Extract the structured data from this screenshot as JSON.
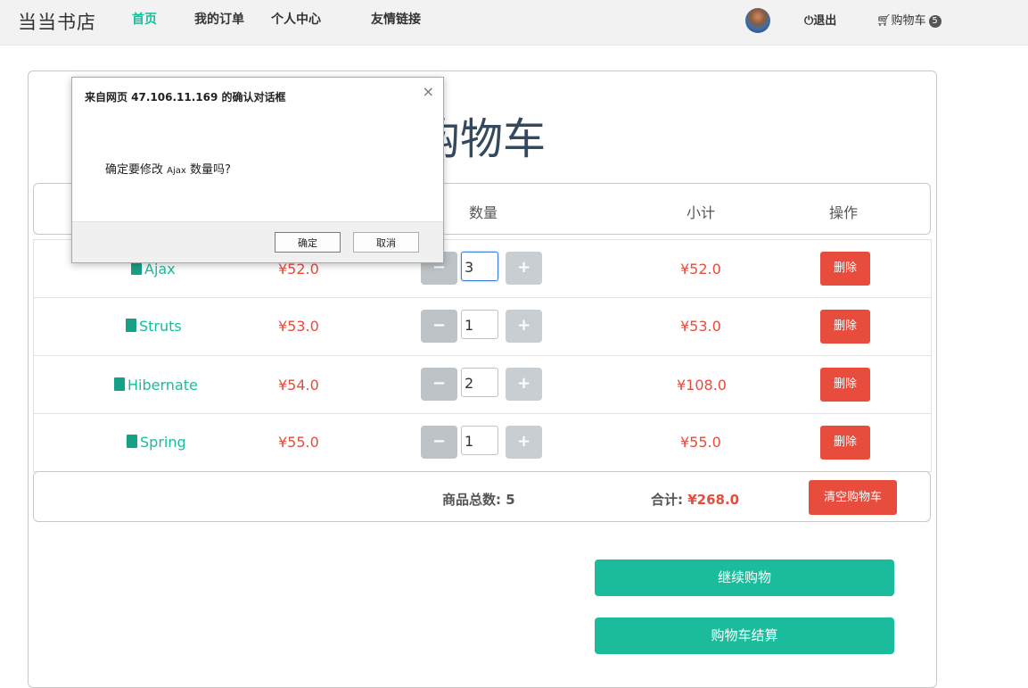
{
  "navbar": {
    "brand": "当当书店",
    "links": [
      "首页",
      "我的订单",
      "个人中心",
      "友情链接"
    ],
    "logout": "退出",
    "cart": "购物车",
    "cart_count": "5"
  },
  "page": {
    "title": "购物车"
  },
  "table": {
    "headers": {
      "qty": "数量",
      "subtotal": "小计",
      "action": "操作"
    },
    "rows": [
      {
        "name": "Ajax",
        "price": "¥52.0",
        "qty": "3",
        "subtotal": "¥52.0",
        "delete": "删除"
      },
      {
        "name": "Struts",
        "price": "¥53.0",
        "qty": "1",
        "subtotal": "¥53.0",
        "delete": "删除"
      },
      {
        "name": "Hibernate",
        "price": "¥54.0",
        "qty": "2",
        "subtotal": "¥108.0",
        "delete": "删除"
      },
      {
        "name": "Spring",
        "price": "¥55.0",
        "qty": "1",
        "subtotal": "¥55.0",
        "delete": "删除"
      }
    ],
    "minus": "−",
    "plus": "+"
  },
  "summary": {
    "count_label": "商品总数:",
    "count_value": "5",
    "sum_label": "合计:",
    "sum_value": "¥268.0",
    "clear": "清空购物车"
  },
  "actions": {
    "continue": "继续购物",
    "checkout": "购物车结算"
  },
  "dialog": {
    "title": "来自网页 47.106.11.169 的确认对话框",
    "message_prefix": "确定要修改",
    "message_item": "Ajax",
    "message_suffix": "数量吗?",
    "ok": "确定",
    "cancel": "取消",
    "close": "×"
  },
  "colors": {
    "accent": "#1abc9c",
    "danger": "#e74c3c",
    "navbar_bg": "#f2f2f2"
  }
}
